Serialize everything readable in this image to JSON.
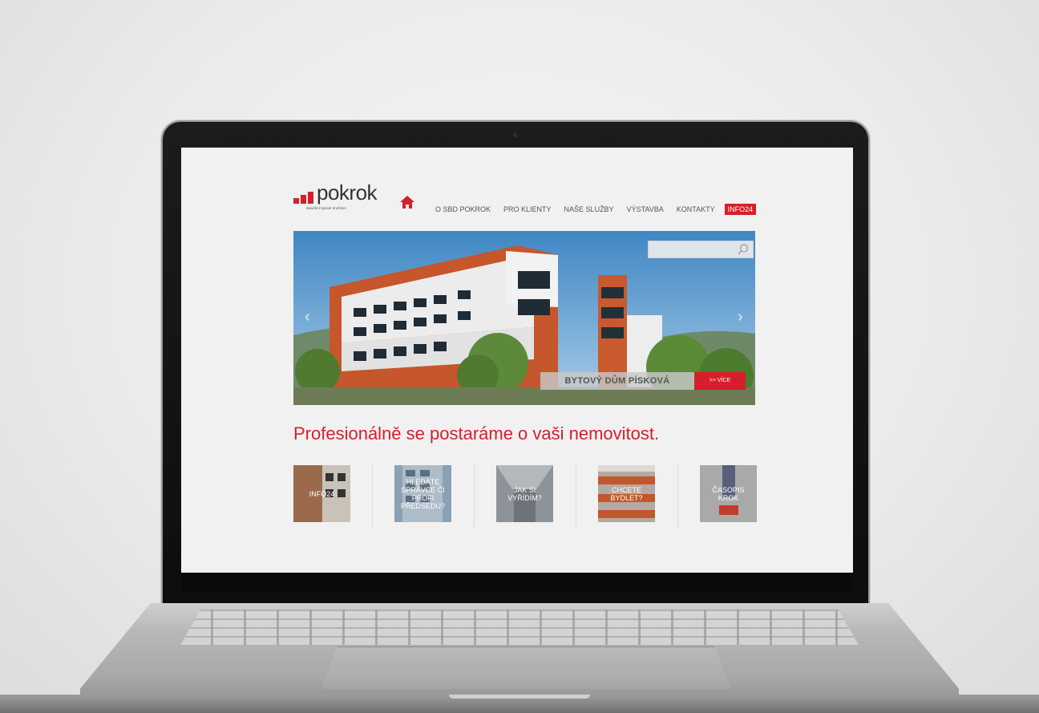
{
  "site": {
    "logo_text": "pokrok",
    "logo_tagline": "stavební bytové družstvo"
  },
  "nav": {
    "items": [
      {
        "label": "O SBD POKROK"
      },
      {
        "label": "PRO KLIENTY"
      },
      {
        "label": "NAŠE SLUŽBY"
      },
      {
        "label": "VÝSTAVBA"
      },
      {
        "label": "KONTAKTY"
      }
    ],
    "highlight": "INFO24"
  },
  "hero": {
    "caption": "BYTOVÝ DŮM PÍSKOVÁ",
    "button": ">> VÍCE",
    "search_placeholder": ""
  },
  "headline": "Profesionálně se postaráme o vaši nemovitost.",
  "tiles": [
    {
      "label": "INFO24"
    },
    {
      "label": "HLEDÁTE SPRÁVCE ČI PROFI PŘEDSEDU?"
    },
    {
      "label": "JAK SI VYŘÍDÍM?"
    },
    {
      "label": "CHCETE BYDLET?"
    },
    {
      "label": "ČASOPIS KROK"
    }
  ],
  "colors": {
    "accent": "#d61f2b",
    "text": "#555555",
    "background": "#f1f1f1"
  }
}
